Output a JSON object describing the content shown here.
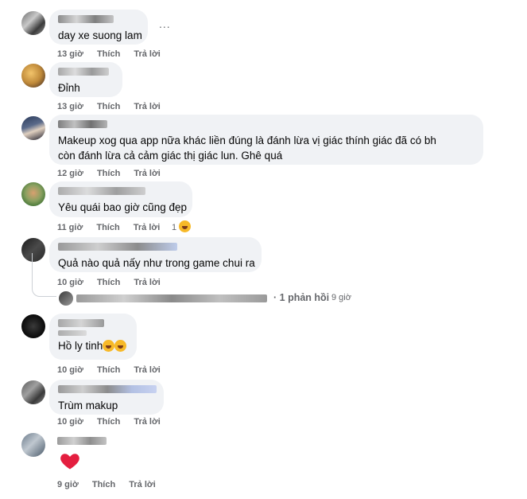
{
  "comments": [
    {
      "text": "day xe suong lam",
      "time": "13 giờ",
      "like": "Thích",
      "reply": "Trả lời"
    },
    {
      "text": "Đỉnh",
      "time": "13 giờ",
      "like": "Thích",
      "reply": "Trả lời"
    },
    {
      "text": "Makeup xog qua app nữa khác liền đúng là đánh lừa vị giác thính giác đã có bh còn đánh lừa cả cảm giác thị giác lun. Ghê quá",
      "time": "12 giờ",
      "like": "Thích",
      "reply": "Trả lời"
    },
    {
      "text": "Yêu quái bao giờ cũng đẹp",
      "time": "11 giờ",
      "like": "Thích",
      "reply": "Trả lời",
      "reaction_count": "1"
    },
    {
      "text": "Quả nào quả nấy như trong game chui ra",
      "time": "10 giờ",
      "like": "Thích",
      "reply": "Trả lời",
      "replies_label": "1 phản hồi",
      "replies_time": "9 giờ"
    },
    {
      "text": "Hồ ly tinh",
      "time": "10 giờ",
      "like": "Thích",
      "reply": "Trả lời"
    },
    {
      "text": "Trùm makup",
      "time": "10 giờ",
      "like": "Thích",
      "reply": "Trả lời"
    },
    {
      "text": "",
      "time": "9 giờ",
      "like": "Thích",
      "reply": "Trả lời"
    }
  ],
  "more_label": "...",
  "colors": {
    "bubble": "#f0f2f5",
    "meta": "#65676b",
    "heart": "#e41e3f",
    "laugh": "#f7b928"
  }
}
